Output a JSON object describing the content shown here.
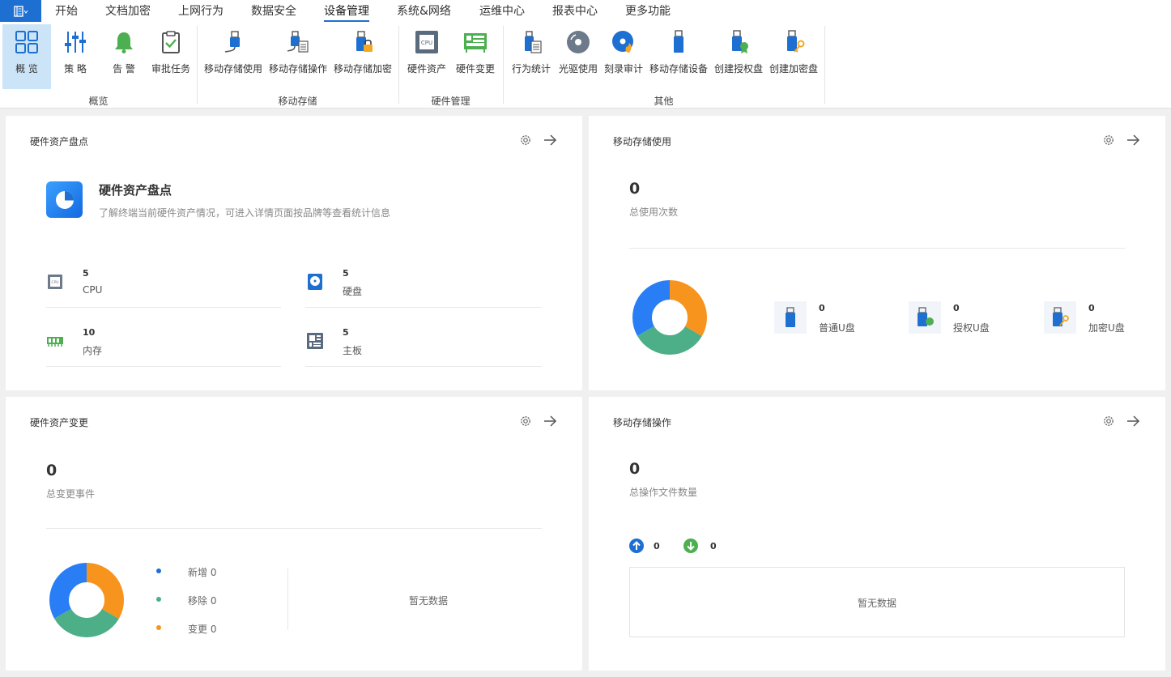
{
  "menu": {
    "items": [
      "开始",
      "文档加密",
      "上网行为",
      "数据安全",
      "设备管理",
      "系统&网络",
      "运维中心",
      "报表中心",
      "更多功能"
    ],
    "active": "设备管理"
  },
  "ribbon": {
    "buttons": [
      "概  览",
      "策  略",
      "告  警",
      "审批任务",
      "移动存储使用",
      "移动存储操作",
      "移动存储加密",
      "硬件资产",
      "硬件变更",
      "行为统计",
      "光驱使用",
      "刻录审计",
      "移动存储设备",
      "创建授权盘",
      "创建加密盘"
    ],
    "groups": [
      "概览",
      "移动存储",
      "硬件管理",
      "其他"
    ],
    "colors": {
      "accent": "#1d6fd2",
      "green": "#4caf50",
      "gold": "#f5a623"
    }
  },
  "hardware_inventory": {
    "title": "硬件资产盘点",
    "intro_title": "硬件资产盘点",
    "intro_desc": "了解终端当前硬件资产情况，可进入详情页面按品牌等查看统计信息",
    "stats": [
      {
        "icon": "cpu-icon",
        "value": "5",
        "label": "CPU"
      },
      {
        "icon": "hard-disk-icon",
        "value": "5",
        "label": "硬盘"
      },
      {
        "icon": "memory-icon",
        "value": "10",
        "label": "内存"
      },
      {
        "icon": "motherboard-icon",
        "value": "5",
        "label": "主板"
      }
    ]
  },
  "storage_usage": {
    "title": "移动存储使用",
    "total": "0",
    "total_label": "总使用次数",
    "items": [
      {
        "icon": "usb-drive-icon",
        "value": "0",
        "label": "普通U盘"
      },
      {
        "icon": "authorized-usb-icon",
        "value": "0",
        "label": "授权U盘"
      },
      {
        "icon": "encrypted-usb-icon",
        "value": "0",
        "label": "加密U盘"
      }
    ],
    "donut_colors": [
      "#f7941d",
      "#4caf87",
      "#2a7ef5"
    ]
  },
  "hardware_change": {
    "title": "硬件资产变更",
    "total": "0",
    "total_label": "总变更事件",
    "legend": [
      {
        "label": "新增 0",
        "color": "#1d6fd2"
      },
      {
        "label": "移除 0",
        "color": "#4caf87"
      },
      {
        "label": "变更 0",
        "color": "#f7941d"
      }
    ],
    "no_data": "暂无数据"
  },
  "storage_ops": {
    "title": "移动存储操作",
    "total": "0",
    "total_label": "总操作文件数量",
    "upload": "0",
    "download": "0",
    "no_data": "暂无数据"
  }
}
